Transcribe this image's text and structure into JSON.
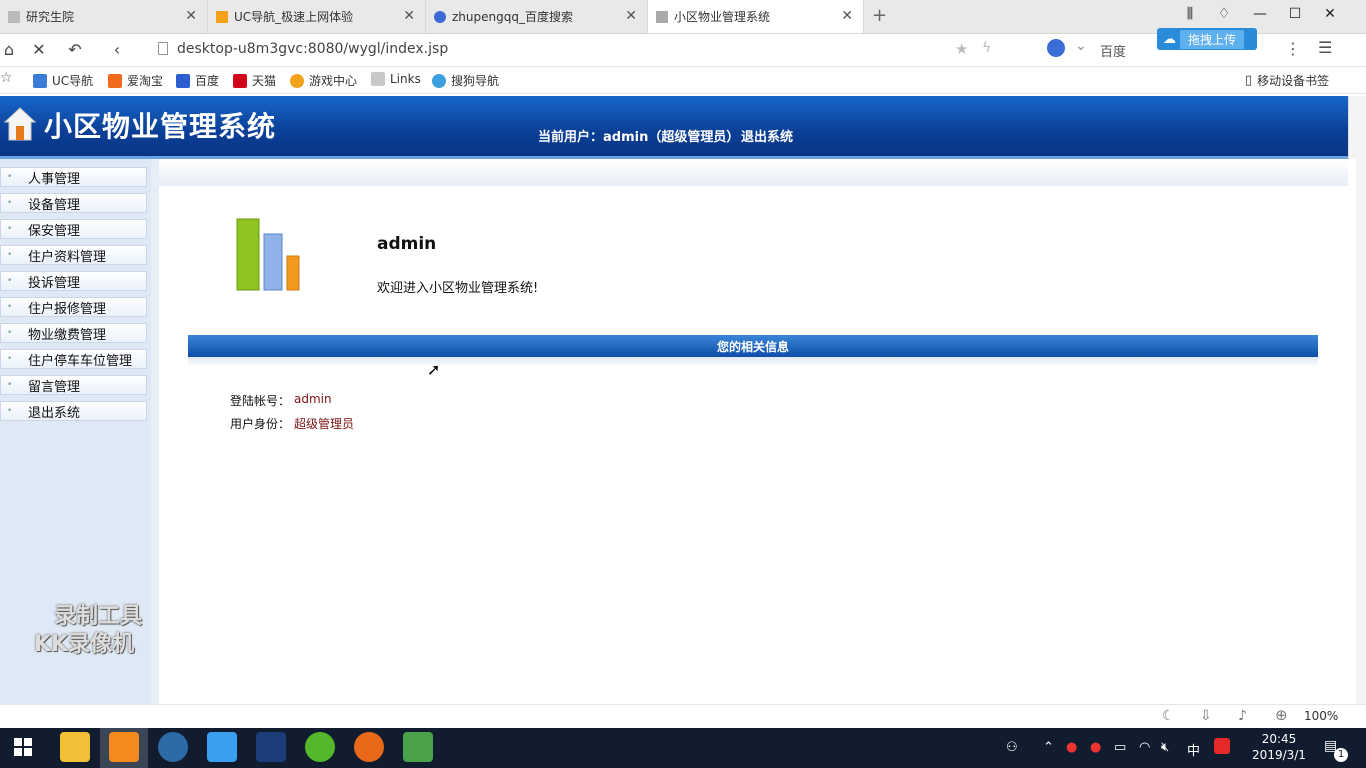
{
  "browser": {
    "tabs": [
      {
        "label": "研究生院",
        "active": false
      },
      {
        "label": "UC导航_极速上网体验",
        "active": false
      },
      {
        "label": "zhupengqq_百度搜索",
        "active": false
      },
      {
        "label": "小区物业管理系统",
        "active": true
      }
    ],
    "new_tab": "+",
    "url": "desktop-u8m3gvc:8080/wygl/index.jsp",
    "search_engine": "百度",
    "upload_label": "拖拽上传",
    "bookmarks": [
      "UC导航",
      "爱淘宝",
      "百度",
      "天猫",
      "游戏中心",
      "Links",
      "搜狗导航"
    ],
    "mobile_bookmarks": "移动设备书签",
    "zoom": "100%"
  },
  "site": {
    "title": "小区物业管理系统",
    "current_user": "当前用户：admin（超级管理员）",
    "logout": "退出系统"
  },
  "sidebar": {
    "items": [
      {
        "label": "人事管理"
      },
      {
        "label": "设备管理"
      },
      {
        "label": "保安管理"
      },
      {
        "label": "住户资料管理"
      },
      {
        "label": "投诉管理"
      },
      {
        "label": "住户报修管理"
      },
      {
        "label": "物业缴费管理"
      },
      {
        "label": "住户停车车位管理"
      },
      {
        "label": "留言管理"
      },
      {
        "label": "退出系统"
      }
    ]
  },
  "main": {
    "username": "admin",
    "welcome": "欢迎进入小区物业管理系统!",
    "info_header": "您的相关信息",
    "fields": [
      {
        "label": "登陆帐号：",
        "value": "admin"
      },
      {
        "label": "用户身份：",
        "value": "超级管理员"
      }
    ]
  },
  "watermark": {
    "line1": "录制工具",
    "line2": "KK录像机"
  },
  "taskbar": {
    "time": "20:45",
    "date": "2019/3/1",
    "ime": "中",
    "notification_count": "1"
  }
}
